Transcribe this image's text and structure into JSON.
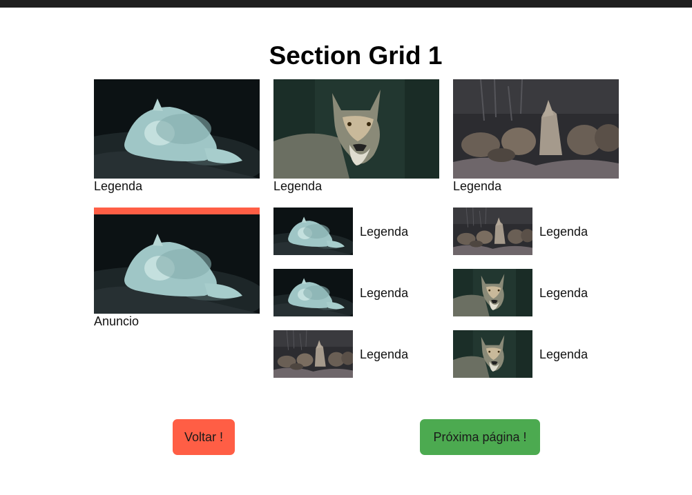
{
  "page": {
    "title": "Section Grid 1"
  },
  "grid": {
    "large_cards": [
      {
        "image": "white-wolf-sleeping",
        "caption": "Legenda"
      },
      {
        "image": "gray-wolf-portrait",
        "caption": "Legenda"
      },
      {
        "image": "wolf-pack-howling",
        "caption": "Legenda"
      }
    ],
    "ad": {
      "image": "white-wolf-sleeping",
      "caption": "Anuncio",
      "accent": "#ff5e45"
    },
    "small_cards_col2": [
      {
        "image": "white-wolf-sleeping",
        "caption": "Legenda"
      },
      {
        "image": "white-wolf-sleeping",
        "caption": "Legenda"
      },
      {
        "image": "wolf-pack-howling",
        "caption": "Legenda"
      }
    ],
    "small_cards_col3": [
      {
        "image": "wolf-pack-howling",
        "caption": "Legenda"
      },
      {
        "image": "gray-wolf-portrait",
        "caption": "Legenda"
      },
      {
        "image": "gray-wolf-portrait",
        "caption": "Legenda"
      }
    ]
  },
  "buttons": {
    "back_label": "Voltar !",
    "back_color": "#ff5e45",
    "next_label": "Próxima página !",
    "next_color": "#4caa50"
  }
}
